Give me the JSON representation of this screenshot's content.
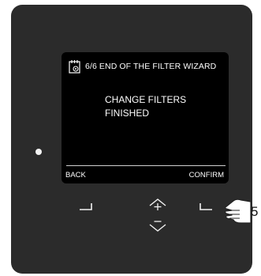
{
  "screen": {
    "title": "6/6 END OF THE FILTER WIZARD",
    "message_line1": "CHANGE FILTERS",
    "message_line2": "FINISHED",
    "softkey_left": "BACK",
    "softkey_right": "CONFIRM"
  },
  "callout": {
    "number": "5"
  },
  "icons": {
    "title_icon": "calendar-settings-icon",
    "button_left": "left-softkey-icon",
    "button_up": "up-plus-icon",
    "button_right": "right-softkey-icon",
    "button_down": "down-minus-icon",
    "pointer": "pointing-hand-icon"
  },
  "colors": {
    "panel": "#2b2b2b",
    "screen": "#000000",
    "text": "#ffffff"
  }
}
